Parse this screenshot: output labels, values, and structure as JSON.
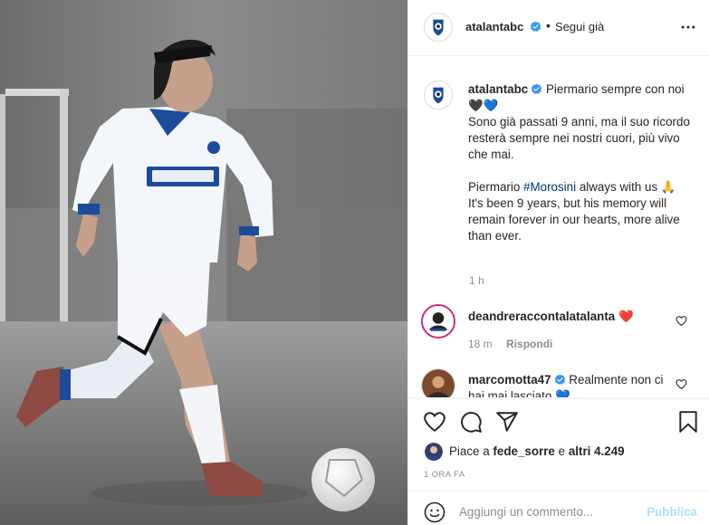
{
  "post": {
    "username": "atalantabc",
    "follow_separator": "•",
    "follow_label": "Segui già",
    "verified": true
  },
  "caption": {
    "username": "atalantabc",
    "line1": "Piermario sempre con",
    "line2_text": "noi",
    "line2_emojis": "🖤💙",
    "it_text": "Sono già passati 9 anni, ma il suo ricordo resterà sempre nei nostri cuori, più vivo che mai.",
    "en_prefix": "Piermario",
    "en_hashtag": "#Morosini",
    "en_suffix": "always with us",
    "pray_emoji": "🙏",
    "en_text": "It's been 9 years, but his memory will remain forever in our hearts, more alive than ever.",
    "time": "1 h"
  },
  "comments": [
    {
      "username": "deandreraccontalatalanta",
      "text": "",
      "emoji": "❤️",
      "time": "18 m",
      "reply": "Rispondi"
    },
    {
      "username": "marcomotta47",
      "text": "Realmente non ci hai mai lasciato 💙"
    }
  ],
  "likes": {
    "prefix": "Piace a",
    "user": "fede_sorre",
    "middle": "e",
    "others": "altri 4.249"
  },
  "post_time": "1 ORA FA",
  "add_comment": {
    "placeholder": "Aggiungi un commento...",
    "publish": "Pubblica"
  },
  "colors": {
    "verified": "#3897f0",
    "heart_red": "#ed4956",
    "link": "#00376b",
    "publish_disabled": "#b2dffc",
    "muted": "#8e8e8e",
    "atalanta_blue": "#1c4b9c"
  },
  "icons": [
    "more-icon",
    "heart-icon",
    "comment-icon",
    "share-icon",
    "bookmark-icon",
    "emoji-icon",
    "verified-icon",
    "like-heart-icon"
  ]
}
